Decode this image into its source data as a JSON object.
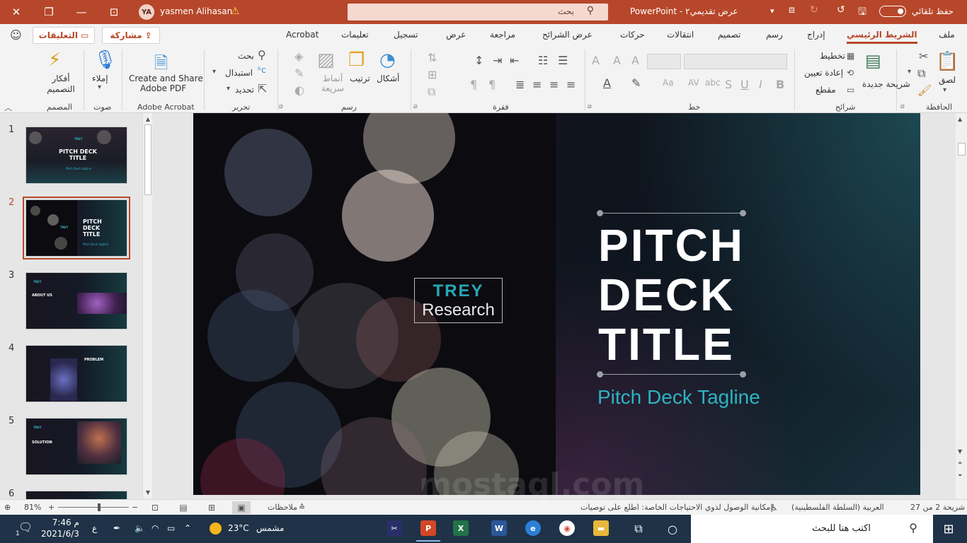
{
  "titlebar": {
    "user_initials": "YA",
    "user_name": "yasmen Alihasan",
    "search_placeholder": "بحث",
    "document_title": "PowerPoint  -  عرض تقديمي٢",
    "autosave_label": "حفظ تلقائي"
  },
  "tabs": [
    "ملف",
    "الشريط الرئيسي",
    "إدراج",
    "رسم",
    "تصميم",
    "انتقالات",
    "حركات",
    "عرض الشرائح",
    "مراجعة",
    "عرض",
    "تسجيل",
    "تعليمات",
    "Acrobat"
  ],
  "share_label": "مشاركة",
  "comments_label": "التعليقات",
  "ribbon": {
    "clipboard": {
      "label": "الحافظة",
      "paste": "لصق"
    },
    "slides": {
      "label": "شرائح",
      "new_slide": "شريحة جديدة",
      "layout": "تخطيط",
      "reset": "إعادة تعيين",
      "section": "مقطع"
    },
    "font": {
      "label": "خط"
    },
    "paragraph": {
      "label": "فقرة"
    },
    "drawing": {
      "label": "رسم",
      "shapes": "أشكال",
      "arrange": "ترتيب",
      "quick_styles": "أنماط سريعة"
    },
    "editing": {
      "label": "تحرير",
      "find": "بحث",
      "replace": "استبدال",
      "select": "تحديد"
    },
    "acrobat": {
      "label": "Adobe Acrobat",
      "line1": "Create and Share",
      "line2": "Adobe PDF"
    },
    "voice": {
      "label": "صوت",
      "dictate": "إملاء"
    },
    "designer": {
      "label": "المصمم",
      "ideas": "أفكار التصميم"
    }
  },
  "thumbnails": [
    {
      "num": "1",
      "title": "PITCH DECK TITLE",
      "tag": "Pitch Deck tagline",
      "selected": false
    },
    {
      "num": "2",
      "title": "PITCH DECK TITLE",
      "tag": "Pitch Deck tagline",
      "selected": true
    },
    {
      "num": "3",
      "title": "ABOUT US",
      "tag": "",
      "selected": false
    },
    {
      "num": "4",
      "title": "PROBLEM",
      "tag": "",
      "selected": false
    },
    {
      "num": "5",
      "title": "SOLUTION",
      "tag": "",
      "selected": false
    },
    {
      "num": "6",
      "title": "",
      "tag": "",
      "selected": false
    }
  ],
  "slide": {
    "logo_line1": "TREY",
    "logo_line2": "Research",
    "title_lines": [
      "PITCH",
      "DECK",
      "TITLE"
    ],
    "tagline": "Pitch Deck Tagline"
  },
  "statusbar": {
    "slide_counter": "شريحة 2 من 27",
    "language": "العربية (السلطة الفلسطينية)",
    "accessibility": "إمكانية الوصول لذوي الاحتياجات الخاصة: اطلع على توصيات",
    "notes": "ملاحظات",
    "zoom": "81%"
  },
  "taskbar": {
    "search_placeholder": "اكتب هنا للبحث",
    "weather_temp": "23°C",
    "weather_label": "مشمس",
    "time": "7:46 م",
    "date": "2021/6/3",
    "lang": "ع",
    "notification_count": "1"
  },
  "watermark": "mostaql.com",
  "colors": {
    "accent": "#b7472a",
    "teal": "#2fb3c2"
  }
}
